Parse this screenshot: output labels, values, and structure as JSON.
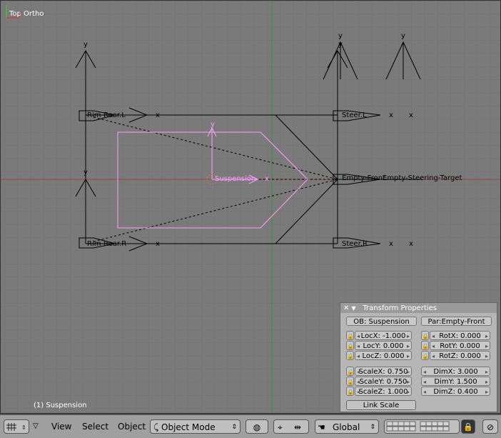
{
  "viewport": {
    "title": "Top Ortho",
    "status": "(1) Suspension",
    "objects": {
      "rim_rear_l": "Rim-Rear.L",
      "rim_rear_r": "Rim-Rear.R",
      "steer_l": "Steer.L",
      "steer_r": "Steer.R",
      "suspension": "Suspension",
      "empty_front": "Empty-Front",
      "empty_steering_target": "Empty-Steering-Target",
      "axis_y": "y",
      "axis_x": "x"
    }
  },
  "panel": {
    "title": "Transform Properties",
    "ob": "OB: Suspension",
    "par": "Par:Empty-Front",
    "loc": [
      "LocX: -1.000",
      "LocY: 0.000",
      "LocZ: 0.000"
    ],
    "rot": [
      "RotX: 0.000",
      "RotY: 0.000",
      "RotZ: 0.000"
    ],
    "scale": [
      "ScaleX: 0.750",
      "ScaleY: 0.750",
      "ScaleZ: 1.000"
    ],
    "dim": [
      "DimX: 3.000",
      "DimY: 1.500",
      "DimZ: 0.400"
    ],
    "link_scale": "Link Scale"
  },
  "header": {
    "view": "View",
    "select": "Select",
    "object": "Object",
    "mode": "Object Mode",
    "orientation": "Global"
  },
  "colors": {
    "viewport_bg": "#7a7a7a",
    "grid": "#6e6e6e",
    "selected": "#ff9cff",
    "x_axis": "#a04040",
    "y_axis": "#3f8f3f"
  }
}
